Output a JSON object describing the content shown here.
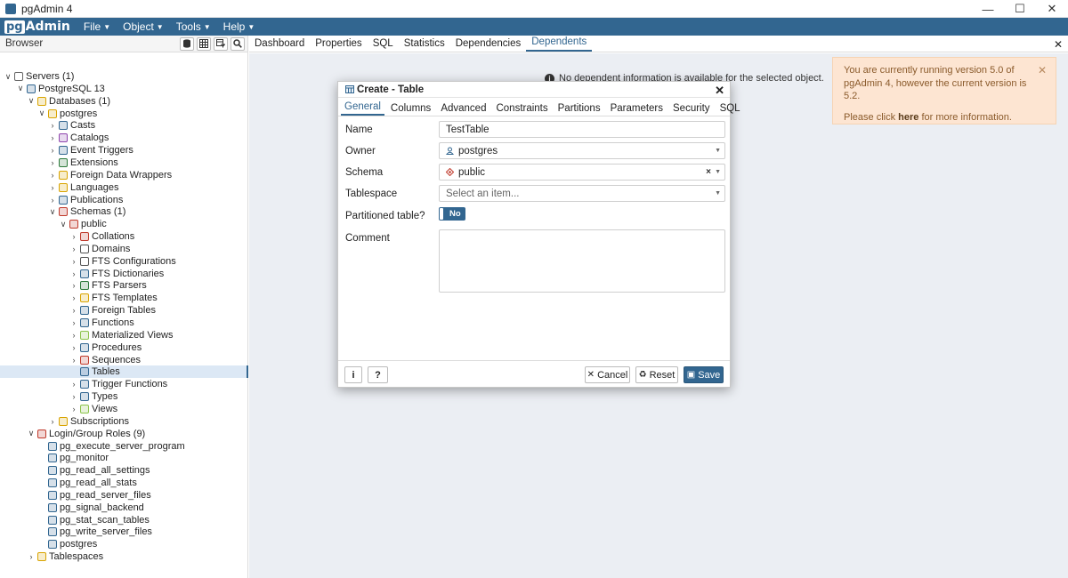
{
  "window": {
    "title": "pgAdmin 4",
    "controls": [
      "—",
      "☐",
      "✕"
    ]
  },
  "menubar": {
    "logo_pg": "pg",
    "logo_rest": "Admin",
    "menus": [
      "File",
      "Object",
      "Tools",
      "Help"
    ]
  },
  "browser": {
    "title": "Browser",
    "tree": [
      {
        "label": "Servers (1)",
        "chev": "∨"
      },
      {
        "label": "PostgreSQL 13",
        "chev": "∨"
      },
      {
        "label": "Databases (1)",
        "chev": "∨"
      },
      {
        "label": "postgres",
        "chev": "∨"
      },
      {
        "label": "Casts",
        "chev": "›"
      },
      {
        "label": "Catalogs",
        "chev": "›"
      },
      {
        "label": "Event Triggers",
        "chev": "›"
      },
      {
        "label": "Extensions",
        "chev": "›"
      },
      {
        "label": "Foreign Data Wrappers",
        "chev": "›"
      },
      {
        "label": "Languages",
        "chev": "›"
      },
      {
        "label": "Publications",
        "chev": "›"
      },
      {
        "label": "Schemas (1)",
        "chev": "∨"
      },
      {
        "label": "public",
        "chev": "∨"
      },
      {
        "label": "Collations",
        "chev": "›"
      },
      {
        "label": "Domains",
        "chev": "›"
      },
      {
        "label": "FTS Configurations",
        "chev": "›"
      },
      {
        "label": "FTS Dictionaries",
        "chev": "›"
      },
      {
        "label": "FTS Parsers",
        "chev": "›"
      },
      {
        "label": "FTS Templates",
        "chev": "›"
      },
      {
        "label": "Foreign Tables",
        "chev": "›"
      },
      {
        "label": "Functions",
        "chev": "›"
      },
      {
        "label": "Materialized Views",
        "chev": "›"
      },
      {
        "label": "Procedures",
        "chev": "›"
      },
      {
        "label": "Sequences",
        "chev": "›"
      },
      {
        "label": "Tables",
        "chev": ""
      },
      {
        "label": "Trigger Functions",
        "chev": "›"
      },
      {
        "label": "Types",
        "chev": "›"
      },
      {
        "label": "Views",
        "chev": "›"
      },
      {
        "label": "Subscriptions",
        "chev": "›"
      },
      {
        "label": "Login/Group Roles (9)",
        "chev": "∨"
      },
      {
        "label": "pg_execute_server_program",
        "chev": ""
      },
      {
        "label": "pg_monitor",
        "chev": ""
      },
      {
        "label": "pg_read_all_settings",
        "chev": ""
      },
      {
        "label": "pg_read_all_stats",
        "chev": ""
      },
      {
        "label": "pg_read_server_files",
        "chev": ""
      },
      {
        "label": "pg_signal_backend",
        "chev": ""
      },
      {
        "label": "pg_stat_scan_tables",
        "chev": ""
      },
      {
        "label": "pg_write_server_files",
        "chev": ""
      },
      {
        "label": "postgres",
        "chev": ""
      },
      {
        "label": "Tablespaces",
        "chev": "›"
      }
    ],
    "selected": "Tables"
  },
  "content_tabs": [
    "Dashboard",
    "Properties",
    "SQL",
    "Statistics",
    "Dependencies",
    "Dependents"
  ],
  "active_content_tab": "Dependents",
  "no_dependent_message": "No dependent information is available for the selected object.",
  "notification": {
    "line1": "You are currently running version 5.0 of pgAdmin 4, however the current version is 5.2.",
    "pre": "Please click ",
    "link": "here",
    "post": " for more information.",
    "close": "✕"
  },
  "dialog": {
    "title": "Create - Table",
    "tabs": [
      "General",
      "Columns",
      "Advanced",
      "Constraints",
      "Partitions",
      "Parameters",
      "Security",
      "SQL"
    ],
    "active_tab": "General",
    "fields": {
      "name_label": "Name",
      "name_value": "TestTable",
      "owner_label": "Owner",
      "owner_value": "postgres",
      "schema_label": "Schema",
      "schema_value": "public",
      "tablespace_label": "Tablespace",
      "tablespace_placeholder": "Select an item...",
      "partitioned_label": "Partitioned table?",
      "partitioned_value": "No",
      "comment_label": "Comment"
    },
    "buttons": {
      "info": "i",
      "help": "?",
      "cancel": "Cancel",
      "reset": "Reset",
      "save": "Save"
    }
  },
  "colors": {
    "brand": "#326690",
    "notify_bg": "#fde5d2",
    "content_bg": "#ebeef3"
  }
}
